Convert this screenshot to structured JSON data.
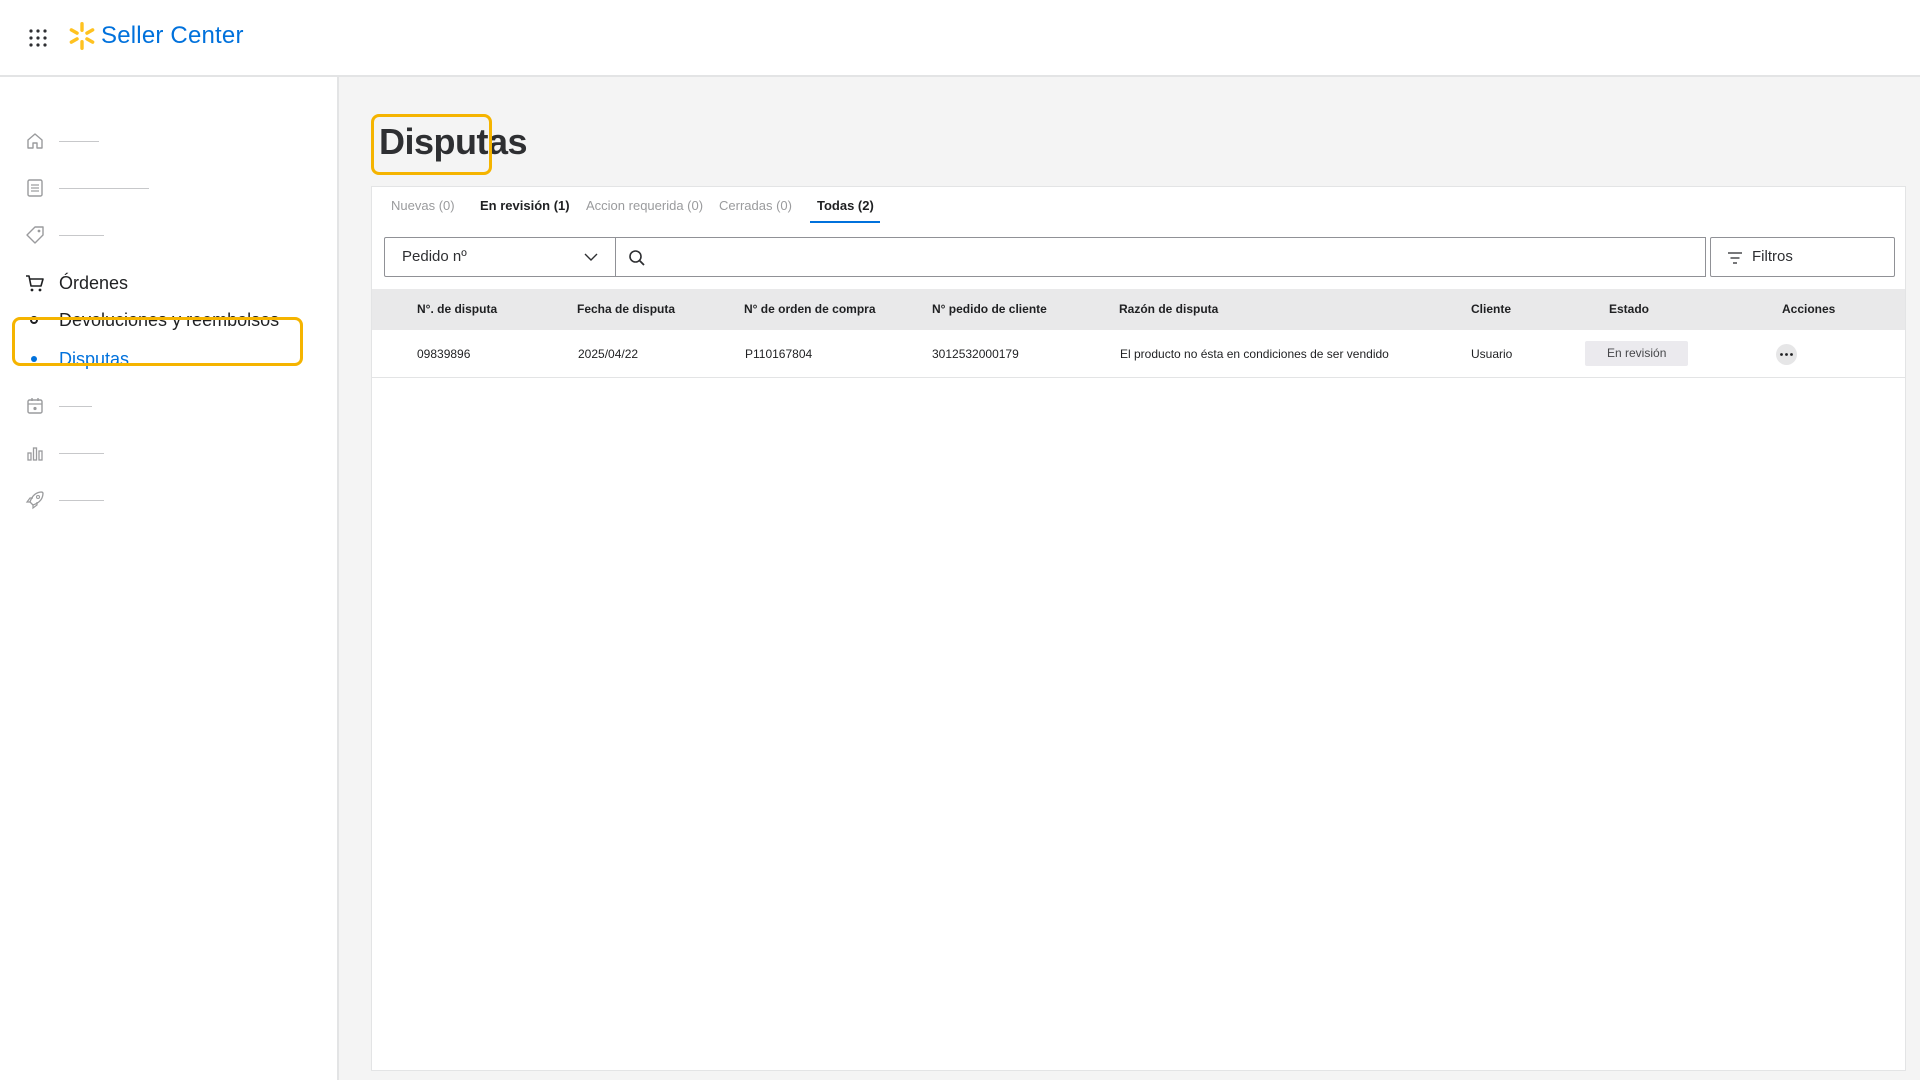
{
  "header": {
    "brand": "Seller Center",
    "brand_color": "#0071dc",
    "spark_color": "#ffc220",
    "apps_icon": "apps-grid-icon",
    "logo_icon": "spark-icon"
  },
  "sidebar": {
    "items": [
      {
        "icon": "home-icon",
        "label": ""
      },
      {
        "icon": "list-icon",
        "label": ""
      },
      {
        "icon": "tag-icon",
        "label": ""
      },
      {
        "icon": "cart-icon",
        "label": "Órdenes"
      },
      {
        "icon": "bullet",
        "label": "Devoluciones y reembolsos"
      },
      {
        "icon": "bullet",
        "label": "Disputas",
        "active": true
      },
      {
        "icon": "calendar-icon",
        "label": ""
      },
      {
        "icon": "bar-chart-icon",
        "label": ""
      },
      {
        "icon": "rocket-icon",
        "label": ""
      }
    ]
  },
  "main": {
    "title": "Disputas",
    "tabs": [
      {
        "label": "Nuevas (0)"
      },
      {
        "label": "En revisión (1)"
      },
      {
        "label": "Accion requerida (0)"
      },
      {
        "label": "Cerradas (0)"
      },
      {
        "label": "Todas (2)",
        "selected": true
      }
    ],
    "filter": {
      "select_value": "Pedido nº",
      "search_value": "",
      "filters_label": "Filtros"
    },
    "table": {
      "columns": [
        "N°. de disputa",
        "Fecha de disputa",
        "N° de orden de compra",
        "N° pedido de cliente",
        "Razón de disputa",
        "Cliente",
        "Estado",
        "Acciones"
      ],
      "rows": [
        {
          "dispute_no": "09839896",
          "date": "2025/04/22",
          "po_no": "P110167804",
          "customer_order": "3012532000179",
          "reason": "El producto no ésta en condiciones de ser vendido",
          "customer": "Usuario",
          "status": "En revisión"
        }
      ]
    }
  },
  "highlight_color": "#f5b400"
}
